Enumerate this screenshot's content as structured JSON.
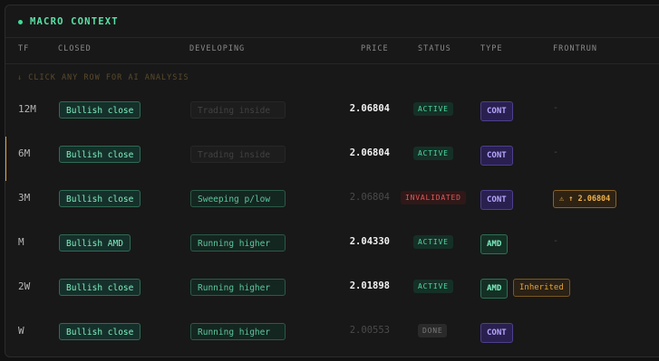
{
  "panel": {
    "title": "MACRO CONTEXT"
  },
  "columns": {
    "tf": "TF",
    "closed": "CLOSED",
    "developing": "DEVELOPING",
    "price": "PRICE",
    "status": "STATUS",
    "type": "TYPE",
    "frontrun": "FRONTRUN"
  },
  "hint": "↓ CLICK ANY ROW FOR AI ANALYSIS",
  "colors": {
    "accent_green": "#3ddc97",
    "accent_orange": "#e2a33c",
    "accent_purple": "#b6a6ff",
    "danger": "#e25858"
  },
  "rows": [
    {
      "tf": "12M",
      "closed": "Bullish close",
      "developing": "Trading inside",
      "price": "2.06804",
      "status": "ACTIVE",
      "type": "CONT",
      "frontrun": "-"
    },
    {
      "tf": "6M",
      "closed": "Bullish close",
      "developing": "Trading inside",
      "price": "2.06804",
      "status": "ACTIVE",
      "type": "CONT",
      "frontrun": "-"
    },
    {
      "tf": "3M",
      "closed": "Bullish close",
      "developing": "Sweeping p/low",
      "price": "2.06804",
      "status": "INVALIDATED",
      "type": "CONT",
      "frontrun": "⚠ ↑ 2.06804"
    },
    {
      "tf": "M",
      "closed": "Bullish AMD",
      "developing": "Running higher",
      "price": "2.04330",
      "status": "ACTIVE",
      "type": "AMD",
      "frontrun": "-"
    },
    {
      "tf": "2W",
      "closed": "Bullish close",
      "developing": "Running higher",
      "price": "2.01898",
      "status": "ACTIVE",
      "type": "AMD",
      "inherited": "Inherited"
    },
    {
      "tf": "W",
      "closed": "Bullish close",
      "developing": "Running higher",
      "price": "2.00553",
      "status": "DONE",
      "type": "CONT",
      "frontrun": "-"
    }
  ]
}
